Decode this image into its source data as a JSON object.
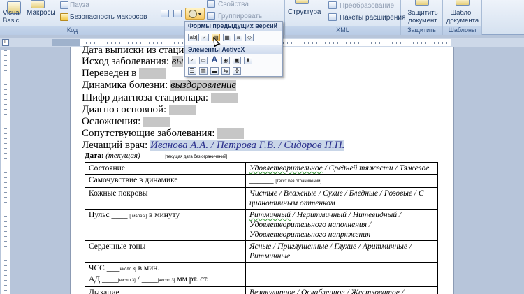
{
  "ribbon": {
    "code_group": {
      "label": "Код",
      "visual_basic": "Visual Basic",
      "macros": "Макросы",
      "pause": "Пауза",
      "macro_security": "Безопасность макросов"
    },
    "controls_group": {
      "properties": "Свойства",
      "group": "Группировать"
    },
    "xml_group": {
      "label": "XML",
      "structure": "Структура",
      "transform": "Преобразование",
      "expansion_packs": "Пакеты расширения"
    },
    "protect_group": {
      "label": "Защитить",
      "protect_document": "Защитить документ"
    },
    "templates_group": {
      "label": "Шаблоны",
      "document_template": "Шаблон документа"
    }
  },
  "popup": {
    "legacy_header": "Формы предыдущих версий",
    "activex_header": "Элементы ActiveX",
    "legacy_icons": [
      "text-field-icon",
      "checkbox-icon",
      "combo-box-icon",
      "frame-icon",
      "shading-icon",
      "reset-icon"
    ],
    "legacy_text_glyph": "ab|",
    "activex_icons": [
      "checkbox-icon",
      "textbox-icon",
      "label-icon",
      "radio-icon",
      "image-icon",
      "spin-icon",
      "list-icon",
      "scroll-icon",
      "button-icon",
      "toggle-icon",
      "more-controls-icon"
    ],
    "activex_label_glyph": "A"
  },
  "document": {
    "lines": {
      "discharge_date": "Дата выписки из стацио",
      "outcome": "Исход заболевания:",
      "outcome_value": "вы",
      "transferred": "Переведен в",
      "dynamics": "Динамика болезни:",
      "dynamics_value": "выздоровление",
      "diag_code": "Шифр диагноза стационара:",
      "main_diag": "Диагноз основной:",
      "complications": "Осложнения:",
      "comorbid": "Сопутствующие заболевания:",
      "doctor": "Лечащий врач:",
      "doctor_value": "Иванова А.А. / Петрова Г.В. / Сидоров П.П."
    },
    "date_row": {
      "label": "Дата:",
      "value": "(текущая)",
      "blank": "______",
      "hint": "[текущая дата без ограничений]"
    },
    "table": {
      "rows": [
        {
          "label": "Состояние",
          "value_parts": [
            "Удовлетворительное",
            " / Средней тяжести / Тяжелое"
          ]
        },
        {
          "label": "Самочувствие в динамике",
          "blank": "______",
          "hint": "[текст без ограничений]"
        },
        {
          "label": "Кожные покровы",
          "value": "Чистые / Влажные / Сухие / Бледные / Розовые / С цианотичным оттенком"
        },
        {
          "label_pre": "Пульс",
          "blank": "____",
          "hint": "[число 3]",
          "label_post": "в минуту",
          "value_parts": [
            "Ритмичный",
            " / Неритмичный / Нитевидный / Удовлетворительного наполнения / Удовлетворительного напряжения"
          ]
        },
        {
          "label": "Сердечные тоны",
          "value": "Ясные / Приглушенные / Глухие / Аритмичные / Ритмичные"
        },
        {
          "chss_label": "ЧСС",
          "chss_blank": "___",
          "chss_hint": "[число 3]",
          "chss_unit": "в мин.",
          "ad_label": "АД",
          "ad_blank1": "____",
          "ad_hint1": "[число 3]",
          "ad_sep": "/",
          "ad_blank2": "____",
          "ad_hint2": "[число 3]",
          "ad_unit": "мм рт. ст."
        },
        {
          "label": "Дыхание",
          "value": "Везикулярное / Ослабленное / Жестковатое /"
        }
      ]
    }
  }
}
